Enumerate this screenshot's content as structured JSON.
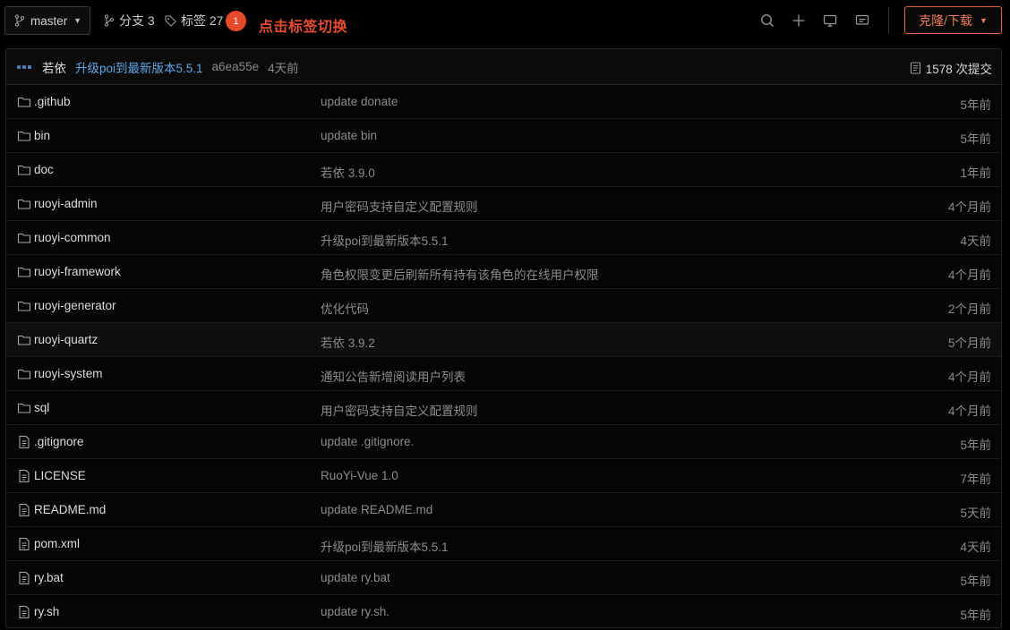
{
  "topbar": {
    "branch": "master",
    "branches_label": "分支 3",
    "tags_label": "标签 27",
    "badge": "1",
    "annotation": "点击标签切换",
    "clone_label": "克隆/下载"
  },
  "commit": {
    "author": "若依",
    "message": "升级poi到最新版本5.5.1",
    "hash": "a6ea55e",
    "time": "4天前",
    "count_label": "1578 次提交"
  },
  "files": [
    {
      "type": "folder",
      "name": ".github",
      "message": "update donate",
      "time": "5年前"
    },
    {
      "type": "folder",
      "name": "bin",
      "message": "update bin",
      "time": "5年前"
    },
    {
      "type": "folder",
      "name": "doc",
      "message": "若依 3.9.0",
      "time": "1年前"
    },
    {
      "type": "folder",
      "name": "ruoyi-admin",
      "message": "用户密码支持自定义配置规则",
      "time": "4个月前"
    },
    {
      "type": "folder",
      "name": "ruoyi-common",
      "message": "升级poi到最新版本5.5.1",
      "time": "4天前"
    },
    {
      "type": "folder",
      "name": "ruoyi-framework",
      "message": "角色权限变更后刷新所有持有该角色的在线用户权限",
      "time": "4个月前"
    },
    {
      "type": "folder",
      "name": "ruoyi-generator",
      "message": "优化代码",
      "time": "2个月前"
    },
    {
      "type": "folder",
      "name": "ruoyi-quartz",
      "message": "若依 3.9.2",
      "time": "5个月前"
    },
    {
      "type": "folder",
      "name": "ruoyi-system",
      "message": "通知公告新增阅读用户列表",
      "time": "4个月前"
    },
    {
      "type": "folder",
      "name": "sql",
      "message": "用户密码支持自定义配置规则",
      "time": "4个月前"
    },
    {
      "type": "file",
      "name": ".gitignore",
      "message": "update .gitignore.",
      "time": "5年前"
    },
    {
      "type": "file",
      "name": "LICENSE",
      "message": "RuoYi-Vue 1.0",
      "time": "7年前"
    },
    {
      "type": "file",
      "name": "README.md",
      "message": "update README.md",
      "time": "5天前"
    },
    {
      "type": "file",
      "name": "pom.xml",
      "message": "升级poi到最新版本5.5.1",
      "time": "4天前"
    },
    {
      "type": "file",
      "name": "ry.bat",
      "message": "update ry.bat",
      "time": "5年前"
    },
    {
      "type": "file",
      "name": "ry.sh",
      "message": "update ry.sh.",
      "time": "5年前"
    }
  ],
  "icons": {
    "branch": "git-branch-icon",
    "branches": "git-fork-icon",
    "tags": "tag-icon",
    "search": "search-icon",
    "plus": "plus-icon",
    "monitor": "monitor-icon",
    "comment": "comment-icon",
    "commits": "commit-list-icon",
    "folder": "folder-icon",
    "file": "file-icon"
  },
  "colors": {
    "accent": "#e8633f",
    "badge": "#e8482b",
    "link": "#5fa6e8"
  }
}
